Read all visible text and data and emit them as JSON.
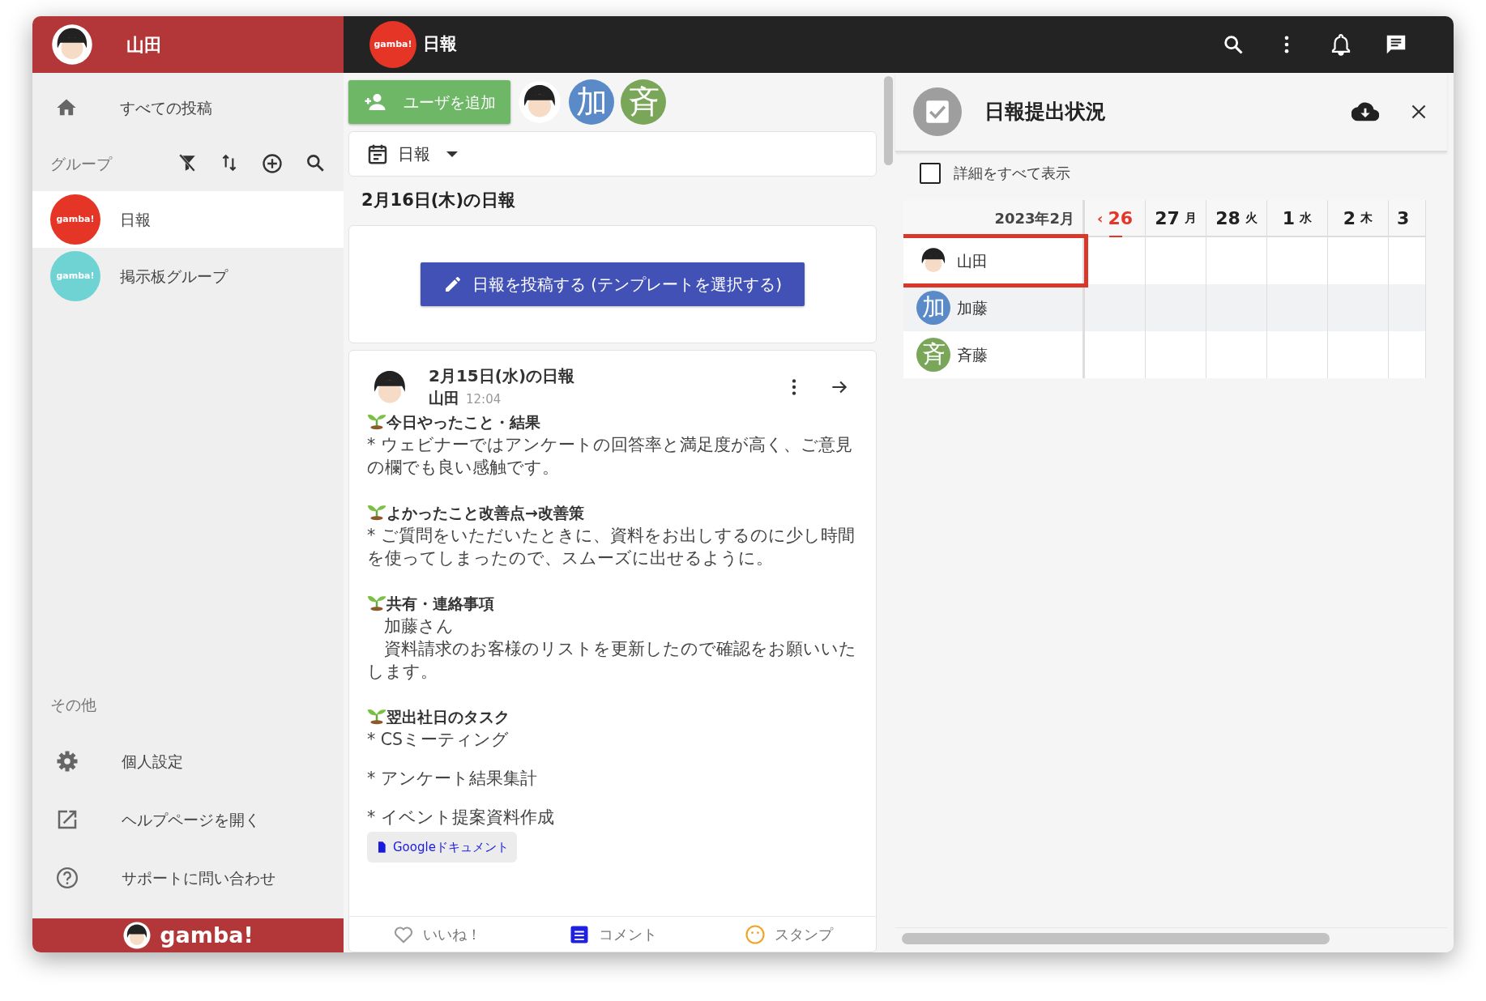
{
  "sidebar": {
    "user": {
      "name": "山田"
    },
    "all_posts": "すべての投稿",
    "groups_label": "グループ",
    "groups": [
      {
        "name": "日報",
        "logo": "gamba!",
        "color": "#e53527",
        "selected": true
      },
      {
        "name": "掲示板グループ",
        "logo": "gamba!",
        "color": "#6fd3d3",
        "selected": false
      }
    ],
    "other_label": "その他",
    "menu": [
      {
        "kind": "settings",
        "label": "個人設定"
      },
      {
        "kind": "external",
        "label": "ヘルプページを開く"
      },
      {
        "kind": "help",
        "label": "サポートに問い合わせ"
      }
    ],
    "footer_brand": "gamba!"
  },
  "topbar": {
    "group_logo": "gamba!",
    "title": "日報"
  },
  "feed": {
    "add_user_button": "ユーザを追加",
    "members": [
      {
        "kind": "photo"
      },
      {
        "kind": "initial",
        "initial": "加",
        "color": "#5b8ac9"
      },
      {
        "kind": "initial",
        "initial": "斉",
        "color": "#7aa65a"
      }
    ],
    "template_select": "日報",
    "today_heading": "2月16日(木)の日報",
    "post_button": "日報を投稿する (テンプレートを選択する)",
    "post": {
      "title": "2月15日(水)の日報",
      "author": "山田",
      "time": "12:04",
      "sections": [
        {
          "heading": "今日やったこと・結果",
          "paragraphs": [
            [
              "* ウェビナーではアンケートの回答率と満足度が高く、ご意見の欄でも良い感触です。"
            ]
          ]
        },
        {
          "heading": "よかったこと改善点→改善策",
          "paragraphs": [
            [
              "* ご質問をいただいたときに、資料をお出しするのに少し時間を使ってしまったので、スムーズに出せるように。"
            ]
          ]
        },
        {
          "heading": "共有・連絡事項",
          "paragraphs": [
            [
              "　加藤さん",
              "　資料請求のお客様のリストを更新したので確認をお願いいたします。"
            ]
          ]
        },
        {
          "heading": "翌出社日のタスク",
          "paragraphs": [
            [
              "* CSミーティング"
            ],
            [
              "* アンケート結果集計"
            ],
            [
              "* イベント提案資料作成"
            ]
          ]
        }
      ],
      "attachment": "Googleドキュメント",
      "actions": [
        {
          "kind": "like",
          "label": "いいね！"
        },
        {
          "kind": "comment",
          "label": "コメント"
        },
        {
          "kind": "stamp",
          "label": "スタンプ"
        }
      ]
    }
  },
  "status_panel": {
    "title": "日報提出状況",
    "show_all_details": {
      "label": "詳細をすべて表示",
      "checked": false
    },
    "calendar": {
      "month": "2023年2月",
      "prev_arrow": "‹",
      "days": [
        {
          "day": "26",
          "today": true
        },
        {
          "day": "27",
          "weekday": "月",
          "today": false
        },
        {
          "day": "28",
          "weekday": "火",
          "today": false
        },
        {
          "day": "1",
          "weekday": "水",
          "today": false
        },
        {
          "day": "2",
          "weekday": "木",
          "today": false
        },
        {
          "day": "3",
          "today": false
        }
      ],
      "rows": [
        {
          "name": "山田",
          "avatar": {
            "kind": "photo"
          },
          "highlighted": true
        },
        {
          "name": "加藤",
          "avatar": {
            "kind": "initial",
            "initial": "加",
            "color": "#5b8ac9"
          },
          "highlighted": false
        },
        {
          "name": "斉藤",
          "avatar": {
            "kind": "initial",
            "initial": "斉",
            "color": "#7aa65a"
          },
          "highlighted": false
        }
      ]
    }
  }
}
